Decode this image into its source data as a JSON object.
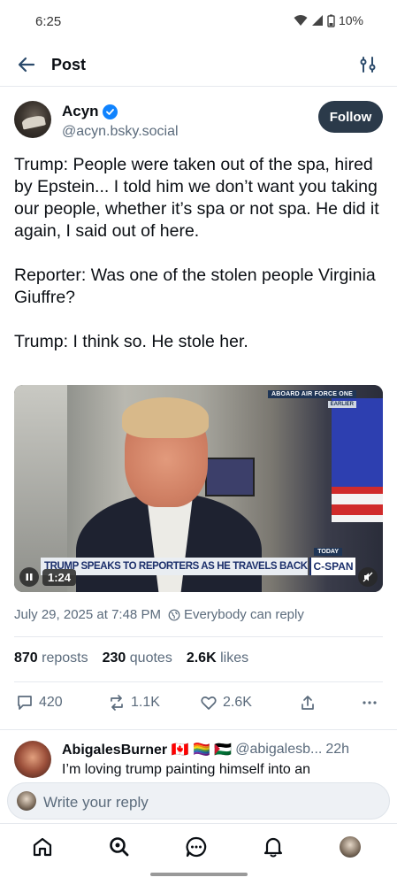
{
  "status_bar": {
    "time": "6:25",
    "battery": "10%"
  },
  "header": {
    "title": "Post"
  },
  "author": {
    "name": "Acyn",
    "handle": "@acyn.bsky.social",
    "follow_label": "Follow"
  },
  "post": {
    "text": "Trump: People were taken out of the spa, hired by Epstein... I told him we don’t want you taking our people, whether it’s spa or not spa. He did it again, I said out of here.\n\nReporter: Was one of the stolen people Virginia Giuffre?\n\nTrump: I think so. He stole her."
  },
  "video": {
    "tag": "ABOARD AIR FORCE ONE",
    "tag2": "EARLIER",
    "today": "TODAY",
    "chyron": "TRUMP SPEAKS TO REPORTERS AS HE TRAVELS BACK TO U.S.",
    "logo": "C-SPAN",
    "duration": "1:24"
  },
  "meta": {
    "timestamp": "July 29, 2025 at 7:48 PM",
    "reply_setting": "Everybody can reply"
  },
  "stats": {
    "reposts_count": "870",
    "reposts_label": "reposts",
    "quotes_count": "230",
    "quotes_label": "quotes",
    "likes_count": "2.6K",
    "likes_label": "likes"
  },
  "actions": {
    "replies": "420",
    "reposts": "1.1K",
    "likes": "2.6K"
  },
  "reply": {
    "name": "AbigalesBurner 🇨🇦 🏳️‍🌈 🇵🇸",
    "handle": "@abigalesb...",
    "time": "22h",
    "text": "I’m loving trump painting himself into an"
  },
  "compose": {
    "placeholder": "Write your reply"
  },
  "colors": {
    "accent": "#1083fe",
    "follow_bg": "#2b3a4a",
    "muted": "#5b6b7c"
  }
}
